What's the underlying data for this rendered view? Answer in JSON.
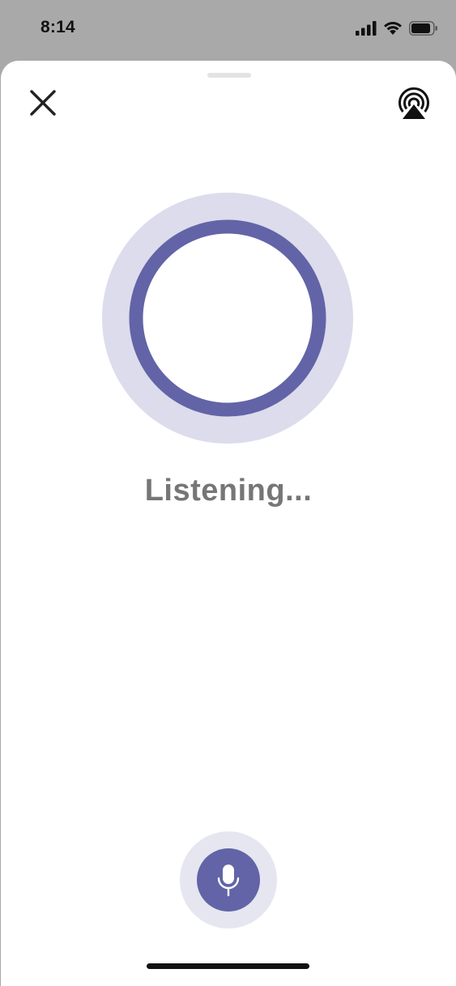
{
  "status_bar": {
    "time": "8:14"
  },
  "listening": {
    "label": "Listening..."
  },
  "colors": {
    "accent": "#6264a7",
    "accent_light": "#dcdcec",
    "text_muted": "#767676"
  },
  "icons": {
    "close": "close-icon",
    "airplay": "airplay-icon",
    "mic": "microphone-icon"
  }
}
